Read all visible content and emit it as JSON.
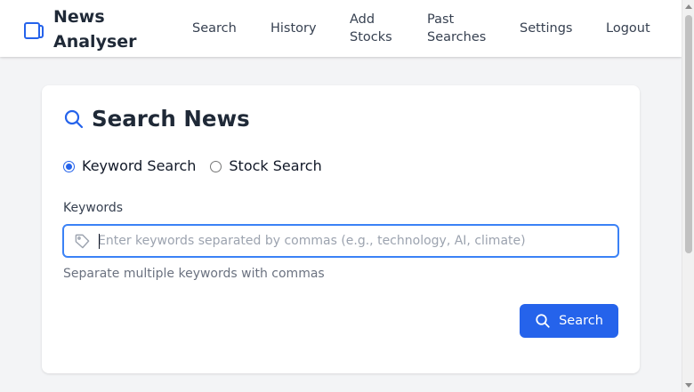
{
  "navbar": {
    "brand_line1": "News",
    "brand_line2": "Analyser",
    "links": {
      "search": "Search",
      "history": "History",
      "add_stocks_1": "Add",
      "add_stocks_2": "Stocks",
      "past_searches_1": "Past",
      "past_searches_2": "Searches",
      "settings": "Settings",
      "logout": "Logout"
    }
  },
  "card": {
    "title": "Search News",
    "search_type": {
      "keyword": "Keyword Search",
      "stock": "Stock Search",
      "selected": "keyword"
    },
    "keywords_label": "Keywords",
    "keywords_value": "",
    "keywords_placeholder": "Enter keywords separated by commas (e.g., technology, AI, climate)",
    "helper": "Separate multiple keywords with commas",
    "search_button": "Search"
  },
  "colors": {
    "accent": "#2563eb",
    "focus_border": "#3b82f6",
    "page_bg": "#f3f4f6"
  },
  "icons": {
    "brand": "tablet-icon",
    "title": "search-icon",
    "input": "tag-icon",
    "button": "search-icon"
  }
}
